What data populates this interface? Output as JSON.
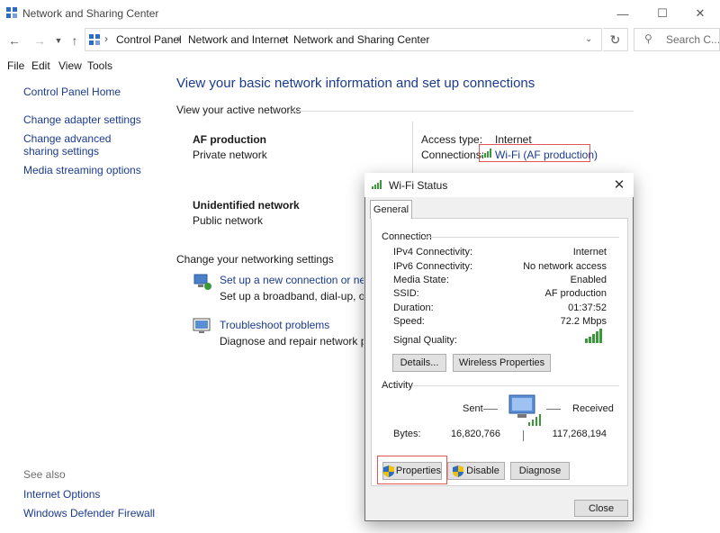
{
  "window": {
    "title": "Network and Sharing Center"
  },
  "address": {
    "crumbs": [
      "Control Panel",
      "Network and Internet",
      "Network and Sharing Center"
    ],
    "search_placeholder": "Search C..."
  },
  "menu": [
    "File",
    "Edit",
    "View",
    "Tools"
  ],
  "sidebar": {
    "links": [
      "Control Panel Home",
      "Change adapter settings",
      "Change advanced sharing settings",
      "Media streaming options"
    ],
    "see_also_label": "See also",
    "see_also": [
      "Internet Options",
      "Windows Defender Firewall"
    ]
  },
  "main": {
    "heading": "View your basic network information and set up connections",
    "active_label": "View your active networks",
    "networks": [
      {
        "name": "AF production",
        "type": "Private network",
        "access_label": "Access type:",
        "access_value": "Internet",
        "conn_label": "Connections:",
        "conn_value": "Wi-Fi (AF production)"
      },
      {
        "name": "Unidentified network",
        "type": "Public network"
      }
    ],
    "change_label": "Change your networking settings",
    "tasks": [
      {
        "title": "Set up a new connection or network",
        "desc": "Set up a broadband, dial-up, or VPN"
      },
      {
        "title": "Troubleshoot problems",
        "desc": "Diagnose and repair network problems"
      }
    ]
  },
  "dialog": {
    "title": "Wi-Fi Status",
    "tab": "General",
    "connection_label": "Connection",
    "rows": [
      {
        "k": "IPv4 Connectivity:",
        "v": "Internet"
      },
      {
        "k": "IPv6 Connectivity:",
        "v": "No network access"
      },
      {
        "k": "Media State:",
        "v": "Enabled"
      },
      {
        "k": "SSID:",
        "v": "AF production"
      },
      {
        "k": "Duration:",
        "v": "01:37:52"
      },
      {
        "k": "Speed:",
        "v": "72.2 Mbps"
      }
    ],
    "signal_label": "Signal Quality:",
    "details_btn": "Details...",
    "wireless_btn": "Wireless Properties",
    "activity_label": "Activity",
    "sent_label": "Sent",
    "received_label": "Received",
    "bytes_label": "Bytes:",
    "bytes_sent": "16,820,766",
    "bytes_received": "117,268,194",
    "properties_btn": "Properties",
    "disable_btn": "Disable",
    "diagnose_btn": "Diagnose",
    "close_btn": "Close"
  },
  "colors": {
    "link": "#1a3a8e",
    "highlight": "#e05555",
    "signal": "#3a9a3a"
  }
}
